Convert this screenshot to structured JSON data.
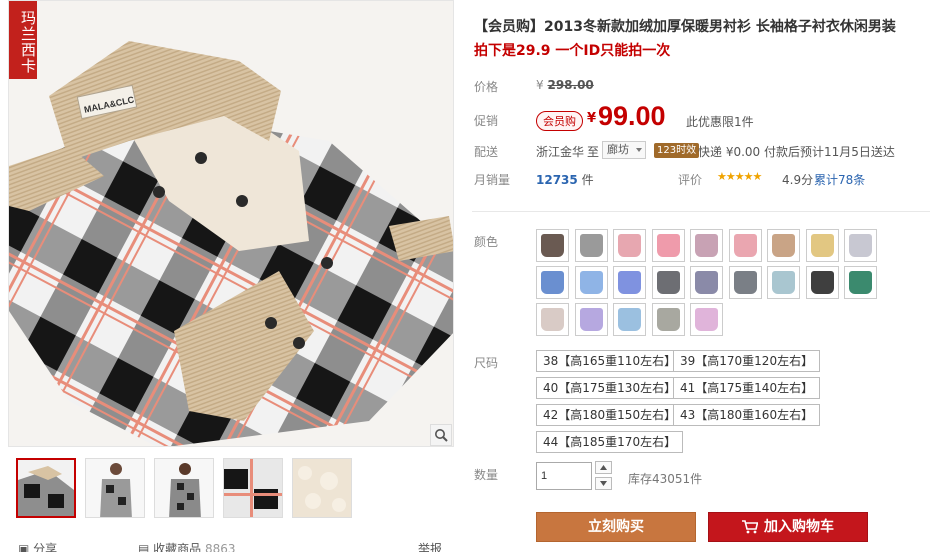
{
  "brand_seal": "玛兰西卡",
  "product": {
    "title": "【会员购】2013冬新款加绒加厚保暖男衬衫 长袖格子衬衣休闲男装",
    "subtitle": "拍下是29.9 一个ID只能拍一次",
    "collar_label": "MALA&CLC"
  },
  "price": {
    "label": "价格",
    "currency": "¥",
    "original": "298.00"
  },
  "promo": {
    "label": "促销",
    "badge": "会员购",
    "currency": "¥",
    "price": "99.00",
    "limit": "此优惠限1件"
  },
  "shipping": {
    "label": "配送",
    "from": "浙江金华",
    "to_word": "至",
    "destination": "廊坊",
    "time_badge": "123时效",
    "delivery": "快递 ¥0.00 付款后预计11月5日送达"
  },
  "sales": {
    "label": "月销量",
    "count": "12735",
    "unit": "件",
    "rating_label": "评价",
    "stars": "★★★★★",
    "score": "4.9分",
    "reviews": "累计78条"
  },
  "colors": {
    "label": "颜色",
    "swatches": [
      "#6a5a52",
      "#9a9a9a",
      "#e7a7b0",
      "#ef9bab",
      "#c8a2b4",
      "#eaa6b0",
      "#c9a486",
      "#e2c782",
      "#c8c8d2",
      "#6a8fd0",
      "#8fb4e6",
      "#7f92e0",
      "#6d6e73",
      "#8a8aa8",
      "#7a7f86",
      "#a9c6d0",
      "#3f3f3f",
      "#3b8a6e",
      "#d9cbc6",
      "#b6a8e0",
      "#9bc0e0",
      "#a8a8a0",
      "#e0b4da"
    ]
  },
  "sizes": {
    "label": "尺码",
    "options": [
      "38【高165重110左右】",
      "39【高170重120左右】",
      "40【高175重130左右】",
      "41【高175重140左右】",
      "42【高180重150左右】",
      "43【高180重160左右】",
      "44【高185重170左右】"
    ]
  },
  "quantity": {
    "label": "数量",
    "value": "1",
    "stock": "库存43051件"
  },
  "actions": {
    "buy_now": "立刻购买",
    "add_to_cart": "加入购物车"
  },
  "bottom_links": {
    "share": "分享",
    "favorite": "收藏商品",
    "favorite_count": "8863",
    "report": "举报"
  }
}
